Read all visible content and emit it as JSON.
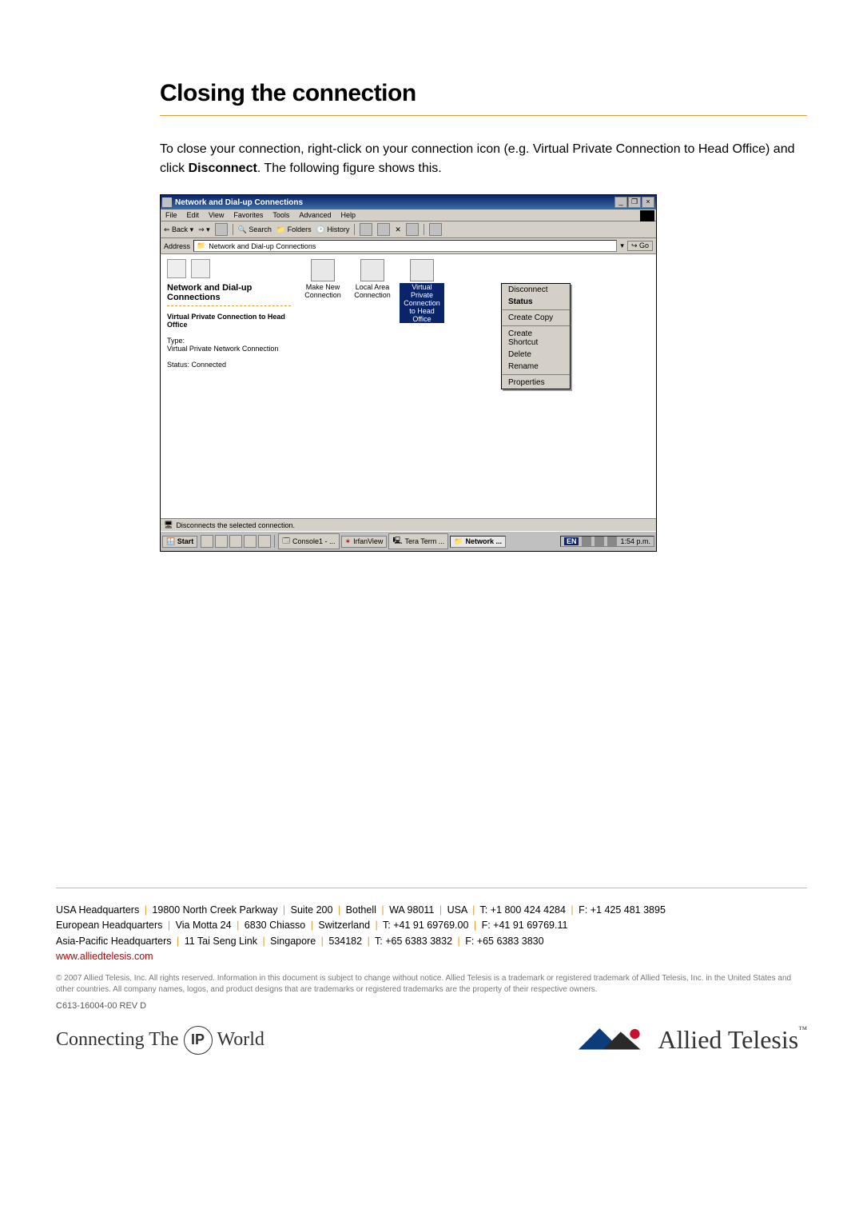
{
  "heading": "Closing the connection",
  "body": {
    "p1a": "To close your connection, right-click on your connection icon (e.g. Virtual Private Connection to Head Office) and click ",
    "p1b": "Disconnect",
    "p1c": ". The following figure shows this."
  },
  "screenshot": {
    "title": "Network and Dial-up Connections",
    "menubar": [
      "File",
      "Edit",
      "View",
      "Favorites",
      "Tools",
      "Advanced",
      "Help"
    ],
    "toolbar": {
      "back": "Back",
      "search": "Search",
      "folders": "Folders",
      "history": "History"
    },
    "address_label": "Address",
    "address_value": "Network and Dial-up Connections",
    "go_label": "Go",
    "sidebar": {
      "title1": "Network and Dial-up",
      "title2": "Connections",
      "sub_title": "Virtual Private Connection to Head Office",
      "type_label": "Type:",
      "type_value": "Virtual Private Network Connection",
      "status_label": "Status: Connected"
    },
    "icons": {
      "make_new": "Make New Connection",
      "local_area": "Local Area Connection",
      "vpn": "Virtual Private Connection to Head Office"
    },
    "context_menu": {
      "disconnect": "Disconnect",
      "status": "Status",
      "create_copy": "Create Copy",
      "create_shortcut": "Create Shortcut",
      "delete": "Delete",
      "rename": "Rename",
      "properties": "Properties"
    },
    "statusbar": "Disconnects the selected connection.",
    "taskbar": {
      "start": "Start",
      "console": "Console1 - ...",
      "irfan": "IrfanView",
      "tera": "Tera Term ...",
      "network": "Network ...",
      "lang": "EN",
      "time": "1:54 p.m."
    }
  },
  "footer": {
    "usa": "USA Headquarters | 19800 North Creek Parkway | Suite 200 | Bothell | WA 98011 | USA | T: +1 800 424 4284 | F: +1 425 481 3895",
    "eu": "European Headquarters | Via Motta 24 | 6830 Chiasso | Switzerland | T: +41 91 69769.00 | F: +41 91 69769.11",
    "ap": "Asia-Pacific Headquarters | 11 Tai Seng Link | Singapore | 534182 | T: +65 6383 3832 | F: +65 6383 3830",
    "url": "www.alliedtelesis.com",
    "legal": "© 2007 Allied Telesis, Inc. All rights reserved. Information in this document is subject to change without notice. Allied Telesis is a trademark or registered trademark of Allied Telesis, Inc. in the United States and other countries. All company names, logos, and product designs that are trademarks or registered trademarks are the property of their respective owners.",
    "doc_id": "C613-16004-00 REV D",
    "connecting_a": "Connecting The",
    "connecting_ip": "IP",
    "connecting_b": "World",
    "brand": "Allied Telesis"
  }
}
